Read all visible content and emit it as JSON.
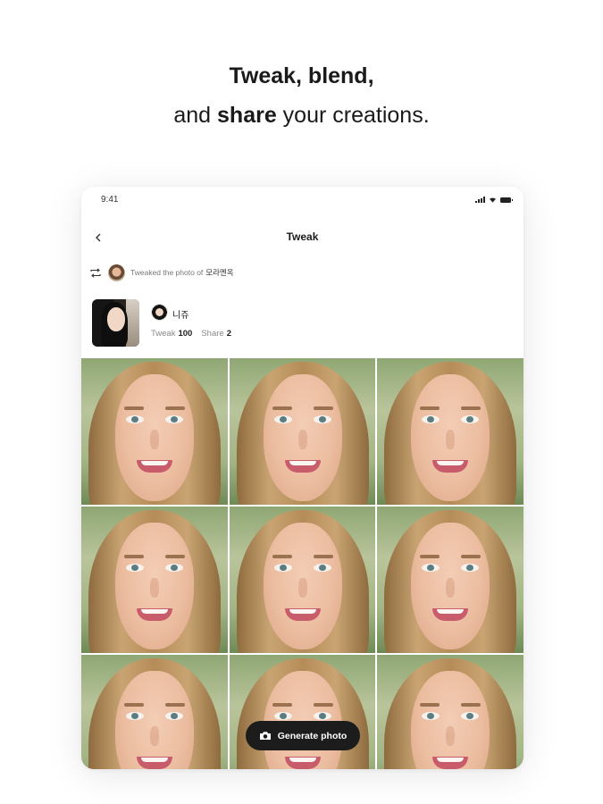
{
  "headline": {
    "line1": "Tweak, blend,",
    "line2_pre": "and ",
    "line2_bold": "share",
    "line2_post": " your creations."
  },
  "status_bar": {
    "time": "9:41"
  },
  "nav": {
    "title": "Tweak"
  },
  "tweaked_from": {
    "text": "Tweaked the photo of",
    "username": "모라멘옥"
  },
  "profile": {
    "name": "니쥬",
    "tweak_label": "Tweak",
    "tweak_count": "100",
    "share_label": "Share",
    "share_count": "2"
  },
  "grid": {
    "rows": 3,
    "columns": 3,
    "photo_count": 9
  },
  "generate_button": {
    "label": "Generate photo",
    "icon": "camera-icon"
  },
  "colors": {
    "button_bg": "#1c1c1c",
    "page_bg": "#ffffff"
  }
}
